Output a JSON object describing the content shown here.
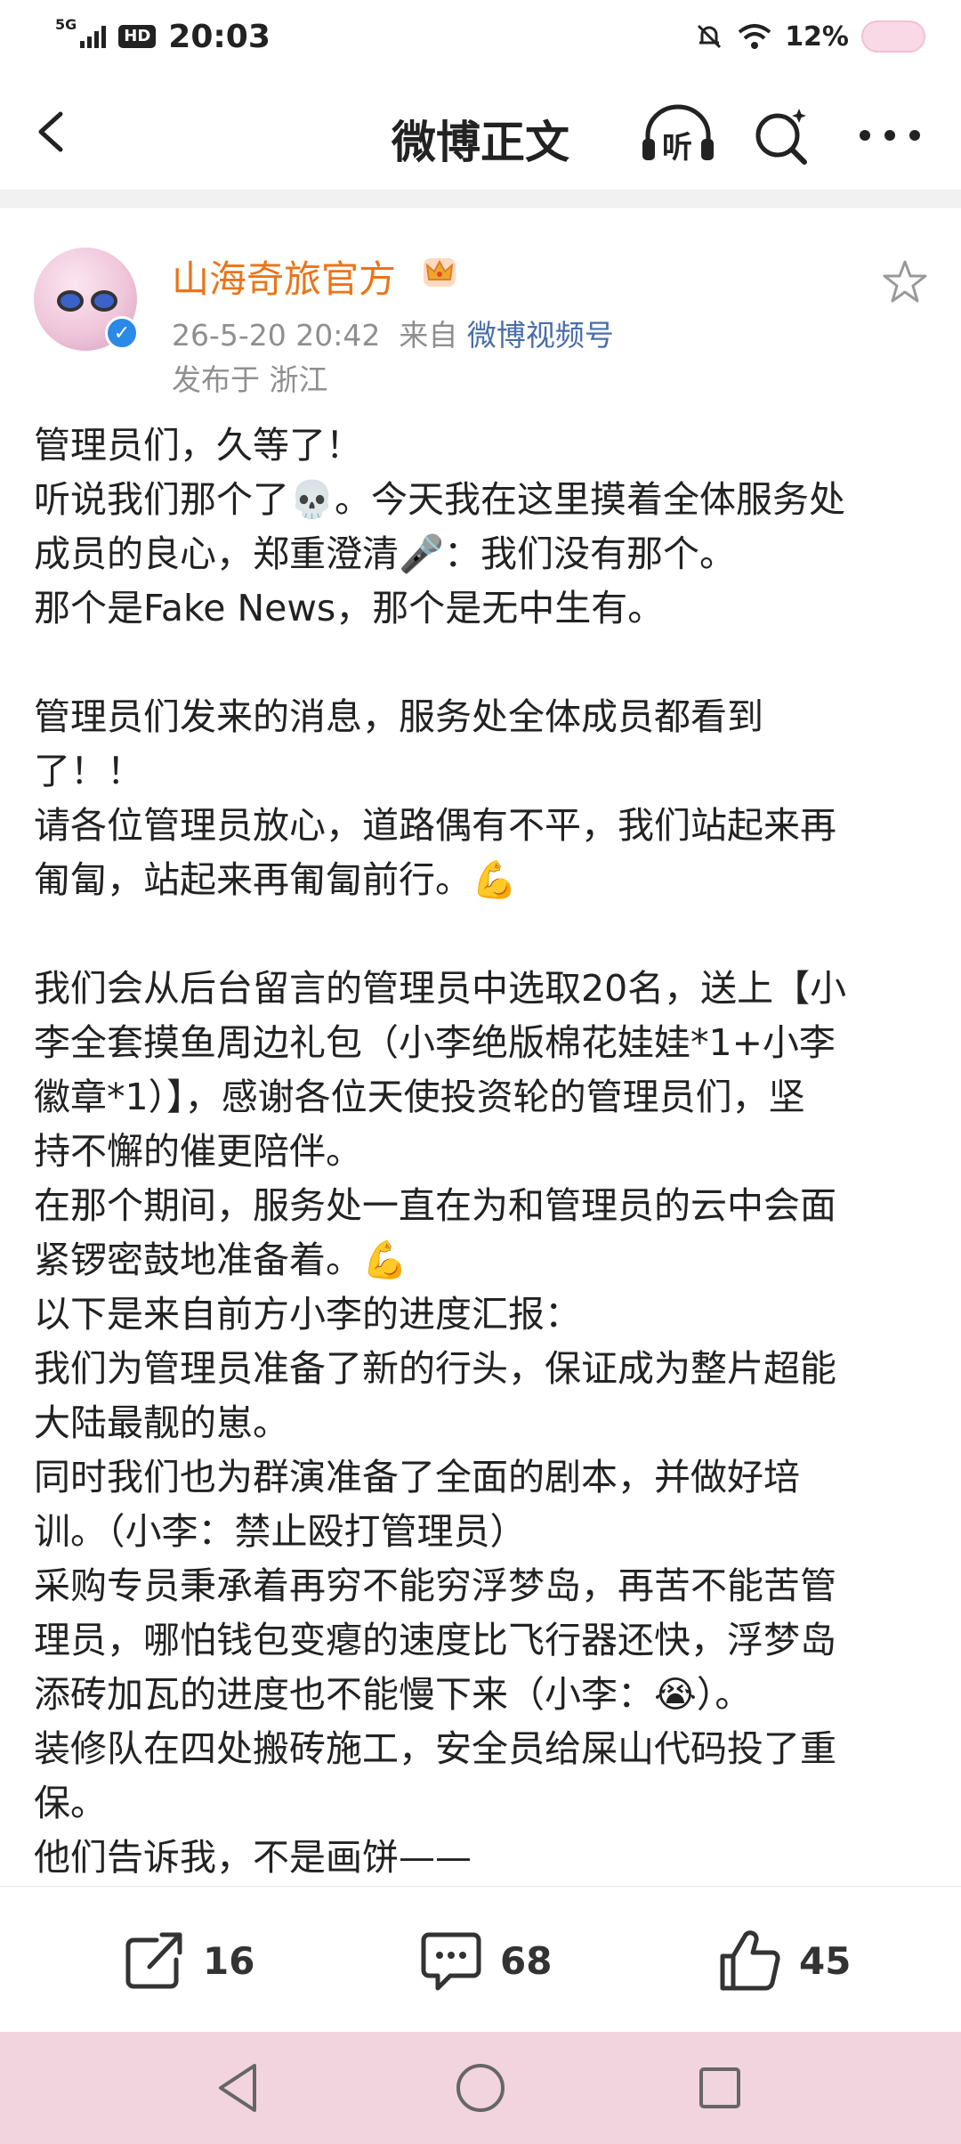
{
  "status_bar": {
    "network": "5G",
    "hd": "HD",
    "time": "20:03",
    "battery": "12%"
  },
  "nav": {
    "title": "微博正文",
    "listen_label": "听"
  },
  "post": {
    "author": "山海奇旅官方",
    "date": "26-5-20 20:42",
    "from_prefix": "来自",
    "source": "微博视频号",
    "location": "发布于 浙江",
    "lines": [
      "管理员们，久等了！",
      "听说我们那个了💀。今天我在这里摸着全体服务处",
      "成员的良心，郑重澄清🎤：我们没有那个。",
      "那个是Fake News，那个是无中生有。",
      "",
      "管理员们发来的消息，服务处全体成员都看到",
      "了！！",
      "请各位管理员放心，道路偶有不平，我们站起来再",
      "匍匐，站起来再匍匐前行。💪",
      "",
      "我们会从后台留言的管理员中选取20名，送上【小",
      "李全套摸鱼周边礼包（小李绝版棉花娃娃*1+小李",
      "徽章*1）】，感谢各位天使投资轮的管理员们，坚",
      "持不懈的催更陪伴。",
      "在那个期间，服务处一直在为和管理员的云中会面",
      "紧锣密鼓地准备着。💪",
      "以下是来自前方小李的进度汇报：",
      "我们为管理员准备了新的行头，保证成为整片超能",
      "大陆最靓的崽。",
      "同时我们也为群演准备了全面的剧本，并做好培",
      "训。（小李：禁止殴打管理员）",
      "采购专员秉承着再穷不能穷浮梦岛，再苦不能苦管",
      "理员，哪怕钱包变瘪的速度比飞行器还快，浮梦岛",
      "添砖加瓦的进度也不能慢下来（小李：😭）。",
      "装修队在四处搬砖施工，安全员给屎山代码投了重",
      "保。",
      "他们告诉我，不是画饼——"
    ]
  },
  "actions": {
    "repost_count": "16",
    "comment_count": "68",
    "like_count": "45"
  },
  "colors": {
    "author": "#eb7418",
    "link": "#4a6ea8",
    "system_nav": "#f2d4de"
  },
  "icons": {
    "back": "chevron-left",
    "listen": "headphones",
    "search": "search-sparkle",
    "more": "three-dots",
    "favorite": "star-outline",
    "crown": "crown",
    "repost": "share-arrow",
    "comment": "speech-bubble",
    "like": "thumbs-up"
  }
}
